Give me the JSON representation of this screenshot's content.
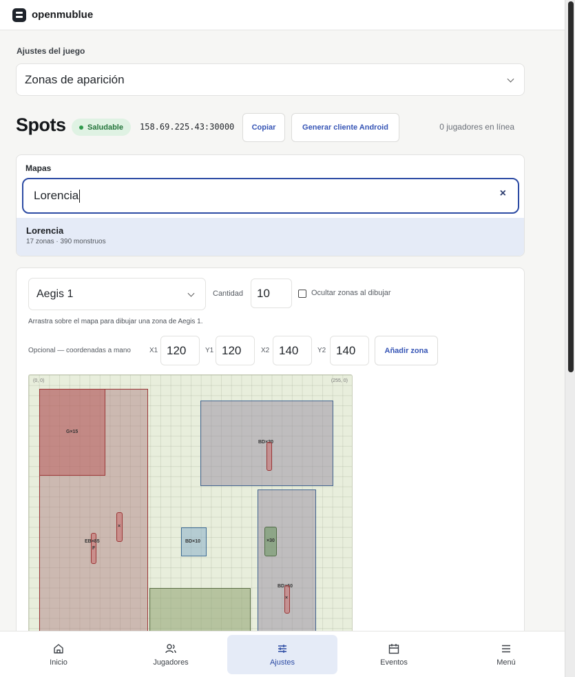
{
  "app": {
    "brand": "openmublue"
  },
  "settings": {
    "label": "Ajustes del juego",
    "section_value": "Zonas de aparición"
  },
  "spots": {
    "title": "Spots",
    "status": "Saludable",
    "address": "158.69.225.43:30000",
    "copy_label": "Copiar",
    "android_label": "Generar cliente Android",
    "online": "0 jugadores en línea"
  },
  "maps": {
    "label": "Mapas",
    "search_value": "Lorencia",
    "clear_icon": "×",
    "result": {
      "name": "Lorencia",
      "meta": "17 zonas · 390 monstruos"
    }
  },
  "editor": {
    "monster_value": "Aegis 1",
    "quantity_label": "Cantidad",
    "quantity_value": "10",
    "hide_zones_label": "Ocultar zonas al dibujar",
    "hint": "Arrastra sobre el mapa para dibujar una zona de Aegis 1.",
    "manual_label": "Opcional — coordenadas a mano",
    "x1_label": "X1",
    "x1_value": "120",
    "y1_label": "Y1",
    "y1_value": "120",
    "x2_label": "X2",
    "x2_value": "140",
    "y2_label": "Y2",
    "y2_value": "140",
    "add_label": "Añadir zona",
    "map": {
      "origin_label": "(0, 0)",
      "corner_label": "(255, 0)",
      "zone_labels": [
        "G×15",
        "BD×20",
        "EB×85",
        "F",
        "BD×10",
        "×30",
        "BD×60",
        "×",
        "×"
      ]
    }
  },
  "nav": {
    "items": [
      {
        "label": "Inicio",
        "icon": "home-icon"
      },
      {
        "label": "Jugadores",
        "icon": "users-icon"
      },
      {
        "label": "Ajustes",
        "icon": "sliders-icon"
      },
      {
        "label": "Eventos",
        "icon": "calendar-icon"
      },
      {
        "label": "Menú",
        "icon": "menu-icon"
      }
    ]
  },
  "colors": {
    "accent": "#2b4aa3",
    "success": "#2f9a4c",
    "active_bg": "#e5ebf7"
  }
}
